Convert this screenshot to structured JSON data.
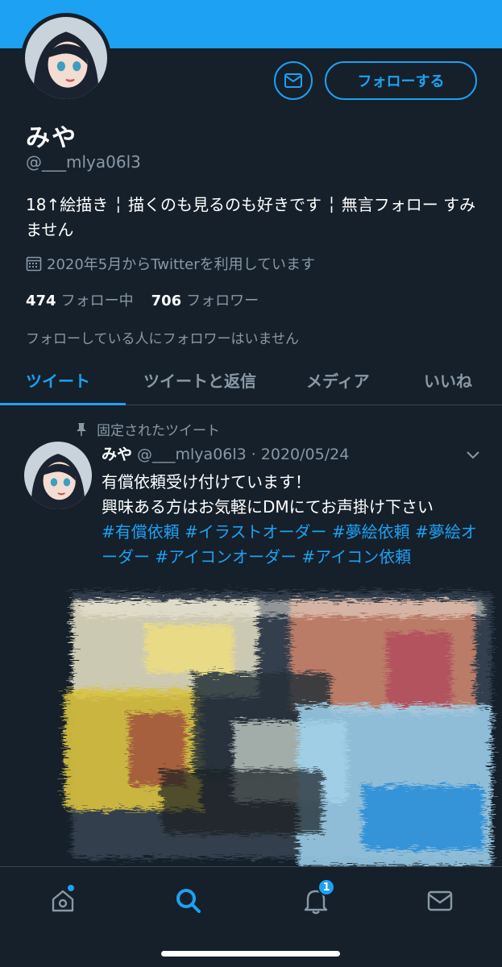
{
  "profile": {
    "display_name": "みや",
    "handle": "@___mlya06l3",
    "bio": "18↑絵描き ╎ 描くのも見るのも好きです ╎ 無言フォロー すみません",
    "joined": "2020年5月からTwitterを利用しています",
    "following_count": "474",
    "following_label": "フォロー中",
    "followers_count": "706",
    "followers_label": "フォロワー",
    "followers_note": "フォローしている人にフォロワーはいません",
    "follow_button_label": "フォローする"
  },
  "tabs": [
    {
      "label": "ツイート",
      "active": true
    },
    {
      "label": "ツイートと返信",
      "active": false
    },
    {
      "label": "メディア",
      "active": false
    },
    {
      "label": "いいね",
      "active": false
    }
  ],
  "tweet": {
    "pinned_label": "固定されたツイート",
    "author_name": "みや",
    "author_handle": "@___mlya06l3",
    "separator": "·",
    "date": "2020/05/24",
    "line1": "有償依頼受け付けています！",
    "line2": "興味ある方はお気軽にDMにてお声掛け下さい",
    "hashtags_text": "#有償依頼 #イラストオーダー #夢絵依頼 #夢絵オーダー #アイコンオーダー #アイコン依頼"
  },
  "bottom_nav": {
    "notification_badge": "1"
  },
  "colors": {
    "background": "#15202b",
    "accent": "#1da1f2",
    "muted": "#8899a6",
    "divider": "#38444d"
  },
  "icons": {
    "message": "envelope-icon",
    "calendar": "calendar-icon",
    "pin": "pin-icon",
    "caret": "chevron-down-icon",
    "home": "home-icon",
    "search": "search-icon",
    "notifications": "bell-icon",
    "messages": "envelope-icon"
  }
}
